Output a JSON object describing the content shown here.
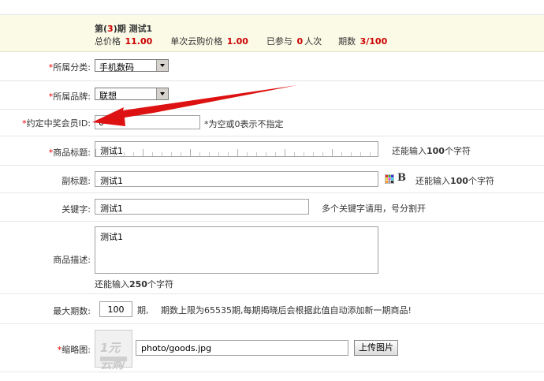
{
  "issue": {
    "title_prefix": "第(",
    "period": "3",
    "title_suffix": ")期 测试1",
    "total_price_label": "总价格",
    "total_price": "11.00",
    "unit_price_label": "单次云购价格",
    "unit_price": "1.00",
    "participated_label": "已参与",
    "participated": "0",
    "participated_unit": "人次",
    "periods_label": "期数",
    "periods": "3/100"
  },
  "form": {
    "category": {
      "required": "*",
      "label": "所属分类:",
      "value": "手机数码"
    },
    "brand": {
      "required": "*",
      "label": "所属品牌:",
      "value": "联想"
    },
    "winner_id": {
      "required": "*",
      "label": "约定中奖会员ID:",
      "value": "0",
      "hint": "*为空或0表示不指定"
    },
    "title": {
      "required": "*",
      "label": "商品标题:",
      "value": "测试1",
      "hint_prefix": "还能输入",
      "hint_count": "100",
      "hint_suffix": "个字符"
    },
    "subtitle": {
      "label": "副标题:",
      "value": "测试1",
      "bold_icon": "B",
      "hint_prefix": "还能输入",
      "hint_count": "100",
      "hint_suffix": "个字符"
    },
    "keywords": {
      "label": "关键字:",
      "value": "测试1",
      "hint": "多个关键字请用，号分割开"
    },
    "description": {
      "label": "商品描述:",
      "value": "测试1",
      "hint_prefix": "还能输入",
      "hint_count": "250",
      "hint_suffix": "个字符"
    },
    "max_periods": {
      "label": "最大期数:",
      "value": "100",
      "unit": "期,",
      "hint": "期数上限为65535期,每期揭晓后会根据此值自动添加新一期商品!"
    },
    "thumbnail": {
      "required": "*",
      "label": "缩略图:",
      "logo_text": "1元云购",
      "path": "photo/goods.jpg",
      "upload_label": "上传图片"
    }
  },
  "colors": {
    "accent_red": "#cc0000",
    "arrow_red": "#dd1111",
    "header_bg": "#fafae6"
  },
  "icons": {
    "color_grid": "color-grid-icon",
    "bold": "bold-icon",
    "arrow": "red-arrow-annotation"
  }
}
